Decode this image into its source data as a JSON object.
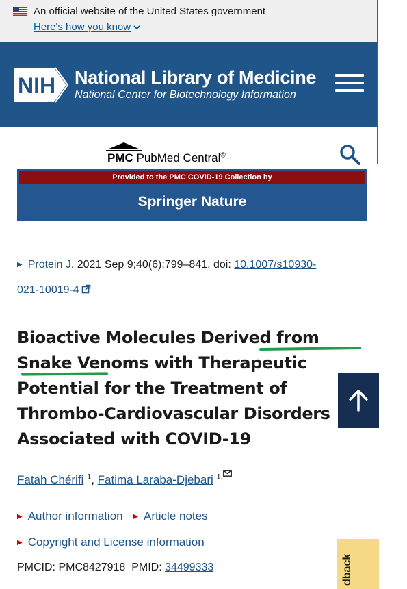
{
  "gov_banner": {
    "text": "An official website of the United States government",
    "link": "Here's how you know"
  },
  "header": {
    "logo_text": "NIH",
    "title": "National Library of Medicine",
    "subtitle": "National Center for Biotechnology Information"
  },
  "pmc": {
    "logo_abbr": "PMC",
    "name": "PubMed Central",
    "reg": "®"
  },
  "publisher_banner": {
    "top_text": "Provided to the PMC COVID-19 Collection by",
    "name": "Springer Nature"
  },
  "citation": {
    "journal": "Protein J",
    "details": ". 2021 Sep 9;40(6):799–841. doi: ",
    "doi_part1": "10.1007/s10930-",
    "doi_part2": "021-10019-4"
  },
  "article": {
    "title_part1": "Bioactive Molecules Derived from Snake Venoms with Therapeutic Potential for the Treatment of Thrombo-Cardiovascular Disorders Associated with COVID-19"
  },
  "authors": [
    {
      "name": "Fatah Chérifi",
      "sup": "1"
    },
    {
      "name": "Fatima Laraba-Djebari",
      "sup": "1,"
    }
  ],
  "expanders": {
    "author_info": "Author information",
    "article_notes": "Article notes",
    "copyright": "Copyright and License information"
  },
  "ids": {
    "pmcid_label": "PMCID: ",
    "pmcid": "PMC8427918",
    "pmid_label": "PMID: ",
    "pmid": "34499333"
  },
  "feedback": {
    "label": "Feedback",
    "visible": "dback"
  },
  "colors": {
    "header_bg": "#20558a",
    "link": "#20558a",
    "highlight": "#1e9e4a",
    "back_to_top_bg": "#162e51",
    "feedback_bg": "#f5d987",
    "springer_red": "#8b0f0f"
  },
  "icons": [
    "us-flag-icon",
    "chevron-down-icon",
    "menu-icon",
    "search-icon",
    "external-link-icon",
    "arrow-up-icon",
    "mail-icon"
  ]
}
